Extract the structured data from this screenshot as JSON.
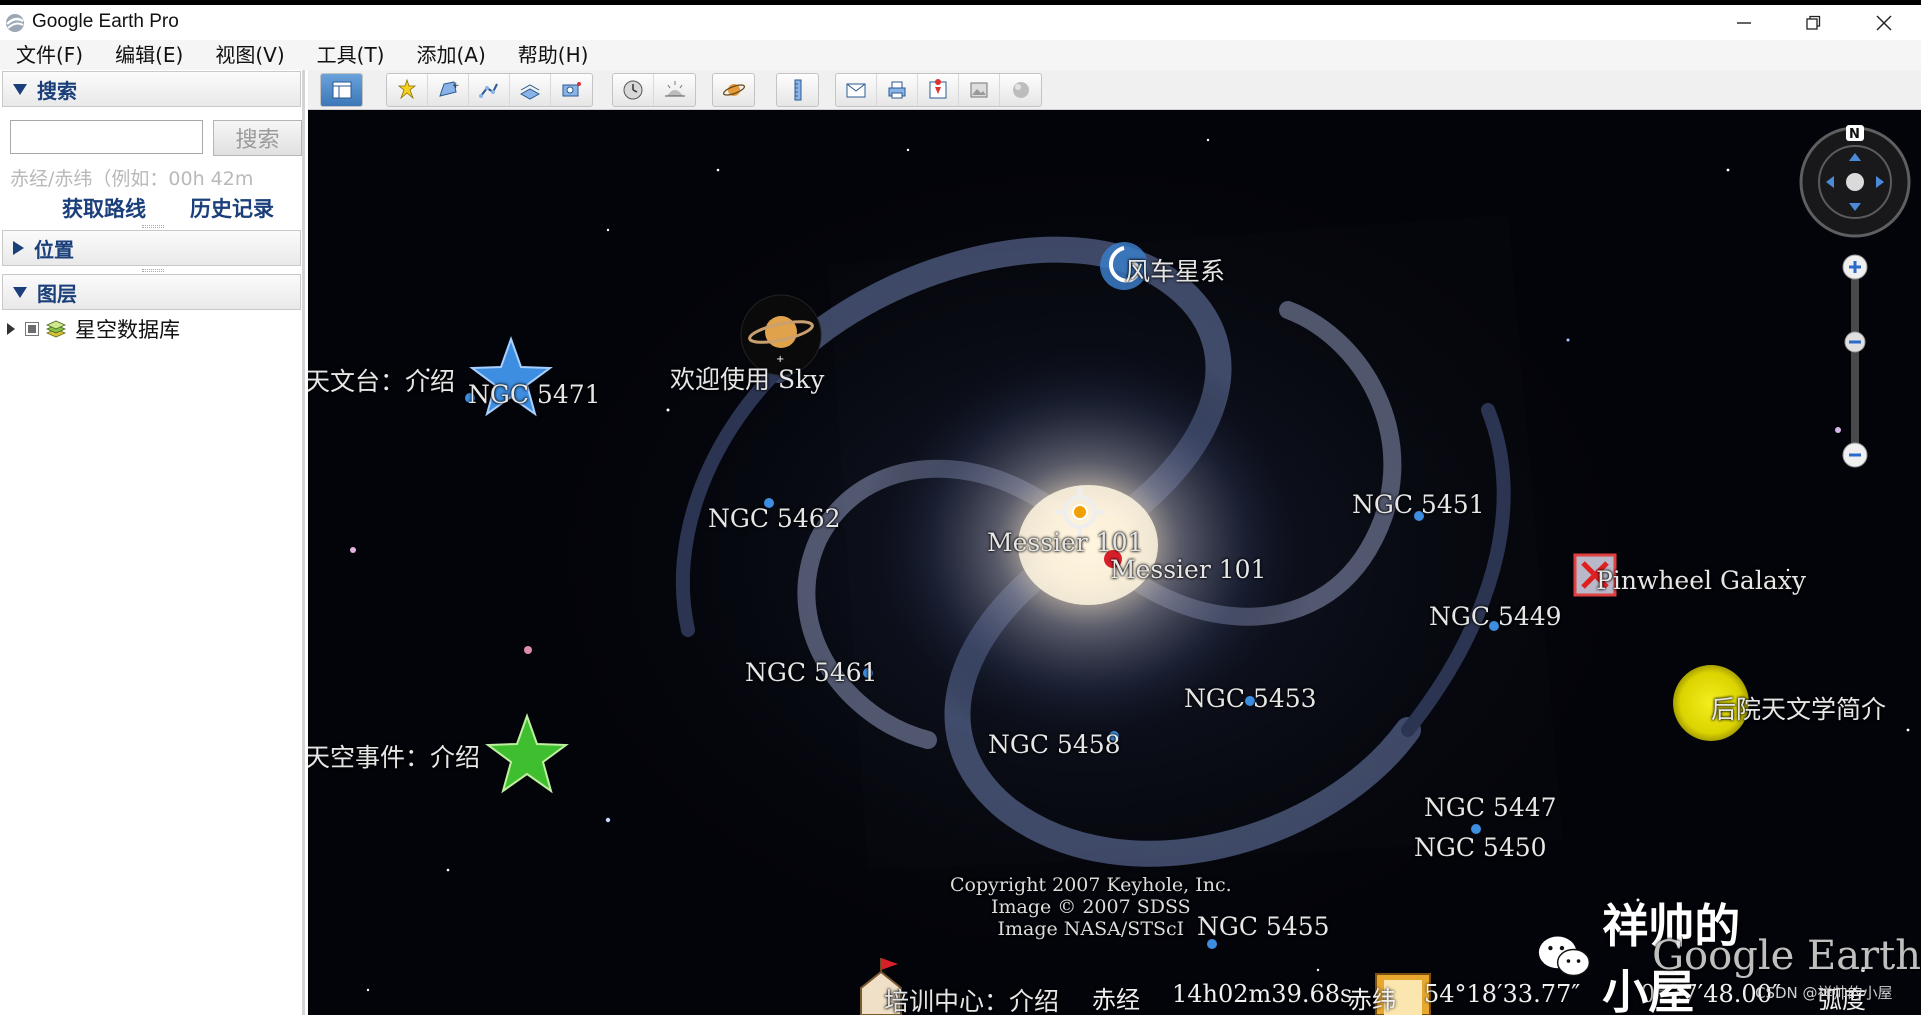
{
  "window": {
    "title": "Google Earth Pro"
  },
  "menu": {
    "items": [
      "文件(F)",
      "编辑(E)",
      "视图(V)",
      "工具(T)",
      "添加(A)",
      "帮助(H)"
    ]
  },
  "sidebar": {
    "search": {
      "header": "搜索",
      "input_value": "",
      "button_label": "搜索",
      "hint": "赤经/赤纬（例如：00h 42m",
      "directions_link": "获取路线",
      "history_link": "历史记录"
    },
    "places": {
      "header": "位置"
    },
    "layers": {
      "header": "图层",
      "items": [
        {
          "label": "星空数据库"
        }
      ]
    }
  },
  "map": {
    "labels": {
      "whirlpool": "风车星系",
      "welcome": "欢迎使用 Sky",
      "observatory": "天文台：介绍",
      "ngc5471": "NGC 5471",
      "ngc5462": "NGC 5462",
      "messier101_a": "Messier 101",
      "messier101_b": "Messier 101",
      "ngc5451": "NGC 5451",
      "pinwheel": "Pinwheel Galaxy",
      "ngc5449": "NGC 5449",
      "ngc5461": "NGC 5461",
      "ngc5453": "NGC 5453",
      "backyard": "后院天文学简介",
      "sky_events": "天空事件：介绍",
      "ngc5458": "NGC 5458",
      "ngc5447": "NGC 5447",
      "ngc5450": "NGC 5450",
      "ngc5455": "NGC 5455",
      "training": "培训中心：介绍"
    },
    "copyright": {
      "line1": "Copyright 2007 Keyhole, Inc.",
      "line2": "Image © 2007 SDSS",
      "line3": "Image NASA/STScI"
    },
    "status": {
      "ra_label": "赤经",
      "ra_value": "14h02m39.68s",
      "dec_label": "赤纬",
      "dec_value": "54°18′33.77″",
      "fov_value": "0°27′48.00″",
      "fov_label": "弧度"
    },
    "compass_north": "N"
  },
  "watermark": {
    "text": "祥帅的小屋",
    "overlay": "Google Earth",
    "source": "CSDN @祥帅的小屋"
  },
  "colors": {
    "link_blue": "#1a3f7a",
    "sky": "#020308",
    "star_blue": "#3d8de0",
    "star_green": "#3fbf2f",
    "yellow_dot": "#e8e000"
  }
}
